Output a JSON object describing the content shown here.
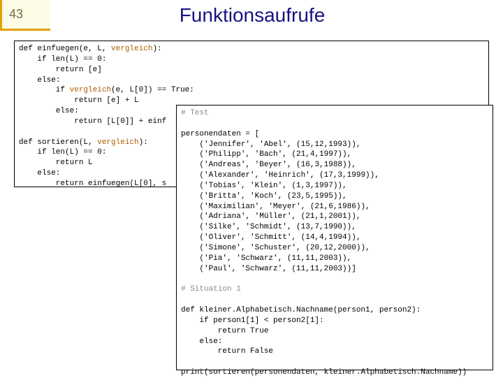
{
  "slide_number": "43",
  "title": "Funktionsaufrufe",
  "code1": {
    "l1a": "def einfuegen(e, L, ",
    "l1b": "vergleich",
    "l1c": "):",
    "l2": "    if len(L) == 0:",
    "l3": "        return [e]",
    "l4": "    else:",
    "l5a": "        if ",
    "l5b": "vergleich",
    "l5c": "(e, L[0]) == True:",
    "l6": "            return [e] + L",
    "l7": "        else:",
    "l8": "            return [L[0]] + einf",
    "l9": "",
    "l10a": "def sortieren(L, ",
    "l10b": "vergleich",
    "l10c": "):",
    "l11": "    if len(L) == 0:",
    "l12": "        return L",
    "l13": "    else:",
    "l14": "        return einfuegen(L[0], s"
  },
  "code2": {
    "c1": "# Test",
    "c2": "",
    "c3": "personendaten = [",
    "c4": "    ('Jennifer', 'Abel', (15,12,1993)),",
    "c5": "    ('Philipp', 'Bach', (21,4,1997)),",
    "c6": "    ('Andreas', 'Beyer', (16,3,1988)),",
    "c7": "    ('Alexander', 'Heinrich', (17,3,1999)),",
    "c8": "    ('Tobias', 'Klein', (1,3,1997)),",
    "c9": "    ('Britta', 'Koch', (23,5,1995)),",
    "c10": "    ('Maximilian', 'Meyer', (21,6,1986)),",
    "c11": "    ('Adriana', 'Müller', (21,1,2001)),",
    "c12": "    ('Silke', 'Schmidt', (13,7,1990)),",
    "c13": "    ('Oliver', 'Schmitt', (14,4,1994)),",
    "c14": "    ('Simone', 'Schuster', (20,12,2000)),",
    "c15": "    ('Pia', 'Schwarz', (11,11,2003)),",
    "c16": "    ('Paul', 'Schwarz', (11,11,2003))]",
    "c17": "",
    "c18": "# Situation 1",
    "c19": "",
    "c20": "def kleiner.Alphabetisch.Nachname(person1, person2):",
    "c21": "    if person1[1] < person2[1]:",
    "c22": "        return True",
    "c23": "    else:",
    "c24": "        return False",
    "c25": "",
    "c26": "print(sortieren(personendaten, kleiner.Alphabetisch.Nachname))"
  }
}
